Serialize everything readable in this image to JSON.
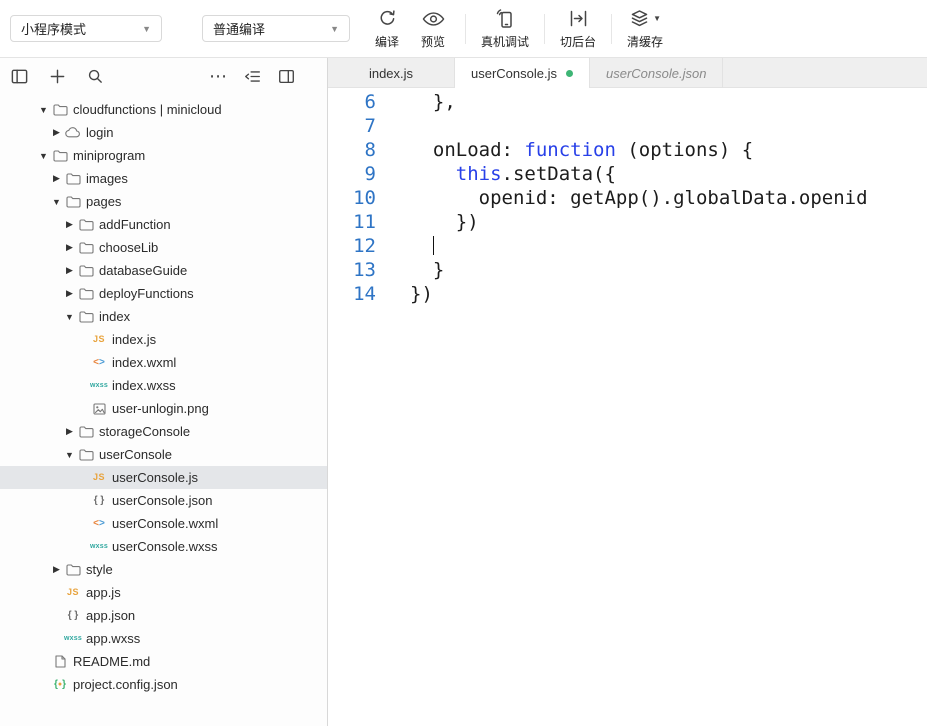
{
  "toolbar": {
    "mode_dropdown": {
      "value": "小程序模式"
    },
    "compile_dropdown": {
      "value": "普通编译"
    },
    "action_groups": [
      [
        {
          "label": "编译",
          "icon": "compile-icon"
        },
        {
          "label": "预览",
          "icon": "preview-icon"
        }
      ],
      [
        {
          "label": "真机调试",
          "icon": "device-debug-icon"
        }
      ],
      [
        {
          "label": "切后台",
          "icon": "switch-background-icon"
        }
      ],
      [
        {
          "label": "清缓存",
          "icon": "clear-cache-icon",
          "has_caret": true
        }
      ]
    ]
  },
  "explorer": {
    "header_icons": {
      "left": [
        "collapse-sidebar-icon",
        "add-file-icon",
        "search-icon"
      ],
      "right": [
        "more-icon",
        "collapse-folders-icon",
        "layout-icon"
      ]
    },
    "tree": [
      {
        "label": "cloudfunctions | minicloud",
        "icon": "folder-icon",
        "level": 0,
        "state": "expanded"
      },
      {
        "label": "login",
        "icon": "cloud-icon",
        "level": 1,
        "state": "collapsed"
      },
      {
        "label": "miniprogram",
        "icon": "folder-icon",
        "level": 0,
        "state": "expanded"
      },
      {
        "label": "images",
        "icon": "folder-icon",
        "level": 1,
        "state": "collapsed"
      },
      {
        "label": "pages",
        "icon": "folder-icon",
        "level": 1,
        "state": "expanded"
      },
      {
        "label": "addFunction",
        "icon": "folder-icon",
        "level": 2,
        "state": "collapsed"
      },
      {
        "label": "chooseLib",
        "icon": "folder-icon",
        "level": 2,
        "state": "collapsed"
      },
      {
        "label": "databaseGuide",
        "icon": "folder-icon",
        "level": 2,
        "state": "collapsed"
      },
      {
        "label": "deployFunctions",
        "icon": "folder-icon",
        "level": 2,
        "state": "collapsed"
      },
      {
        "label": "index",
        "icon": "folder-icon",
        "level": 2,
        "state": "expanded"
      },
      {
        "label": "index.js",
        "icon": "js-file-icon",
        "level": 3,
        "state": "none"
      },
      {
        "label": "index.wxml",
        "icon": "wxml-file-icon",
        "level": 3,
        "state": "none"
      },
      {
        "label": "index.wxss",
        "icon": "wxss-file-icon",
        "level": 3,
        "state": "none"
      },
      {
        "label": "user-unlogin.png",
        "icon": "image-file-icon",
        "level": 3,
        "state": "none"
      },
      {
        "label": "storageConsole",
        "icon": "folder-icon",
        "level": 2,
        "state": "collapsed"
      },
      {
        "label": "userConsole",
        "icon": "folder-icon",
        "level": 2,
        "state": "expanded"
      },
      {
        "label": "userConsole.js",
        "icon": "js-file-icon",
        "level": 3,
        "state": "none",
        "selected": true
      },
      {
        "label": "userConsole.json",
        "icon": "json-file-icon",
        "level": 3,
        "state": "none"
      },
      {
        "label": "userConsole.wxml",
        "icon": "wxml-file-icon",
        "level": 3,
        "state": "none"
      },
      {
        "label": "userConsole.wxss",
        "icon": "wxss-file-icon",
        "level": 3,
        "state": "none"
      },
      {
        "label": "style",
        "icon": "folder-icon",
        "level": 1,
        "state": "collapsed"
      },
      {
        "label": "app.js",
        "icon": "js-file-icon",
        "level": 1,
        "state": "none"
      },
      {
        "label": "app.json",
        "icon": "json-file-icon",
        "level": 1,
        "state": "none"
      },
      {
        "label": "app.wxss",
        "icon": "wxss-file-icon",
        "level": 1,
        "state": "none"
      },
      {
        "label": "README.md",
        "icon": "md-file-icon",
        "level": 0,
        "state": "none"
      },
      {
        "label": "project.config.json",
        "icon": "config-file-icon",
        "level": 0,
        "state": "none"
      }
    ]
  },
  "tabs": [
    {
      "label": "index.js",
      "state": "normal"
    },
    {
      "label": "userConsole.js",
      "state": "active",
      "modified": true
    },
    {
      "label": "userConsole.json",
      "state": "preview"
    }
  ],
  "editor": {
    "lines": [
      {
        "num": 6,
        "tokens": [
          {
            "t": "  },",
            "c": "plain"
          }
        ]
      },
      {
        "num": 7,
        "tokens": []
      },
      {
        "num": 8,
        "tokens": [
          {
            "t": "  onLoad: ",
            "c": "plain"
          },
          {
            "t": "function",
            "c": "keyword"
          },
          {
            "t": " (options) {",
            "c": "plain"
          }
        ]
      },
      {
        "num": 9,
        "tokens": [
          {
            "t": "    ",
            "c": "plain"
          },
          {
            "t": "this",
            "c": "keyword"
          },
          {
            "t": ".setData({",
            "c": "plain"
          }
        ]
      },
      {
        "num": 10,
        "tokens": [
          {
            "t": "      openid: getApp().globalData.openid",
            "c": "plain"
          }
        ]
      },
      {
        "num": 11,
        "tokens": [
          {
            "t": "    })",
            "c": "plain"
          }
        ]
      },
      {
        "num": 12,
        "tokens": [
          {
            "t": "  ",
            "c": "plain"
          }
        ],
        "cursor": true
      },
      {
        "num": 13,
        "tokens": [
          {
            "t": "  }",
            "c": "plain"
          }
        ]
      },
      {
        "num": 14,
        "tokens": [
          {
            "t": "})",
            "c": "plain"
          }
        ]
      }
    ]
  },
  "colors": {
    "keyword": "#2840e8",
    "line_number": "#2e74c5",
    "js_icon": "#e8a33d",
    "wxss_icon": "#31a8a0",
    "wxml_left": "#e8833a",
    "wxml_right": "#4a9ad4",
    "config_brace": "#3eb370",
    "modified_dot": "#3eb575",
    "selected_row": "#e4e6e9"
  }
}
